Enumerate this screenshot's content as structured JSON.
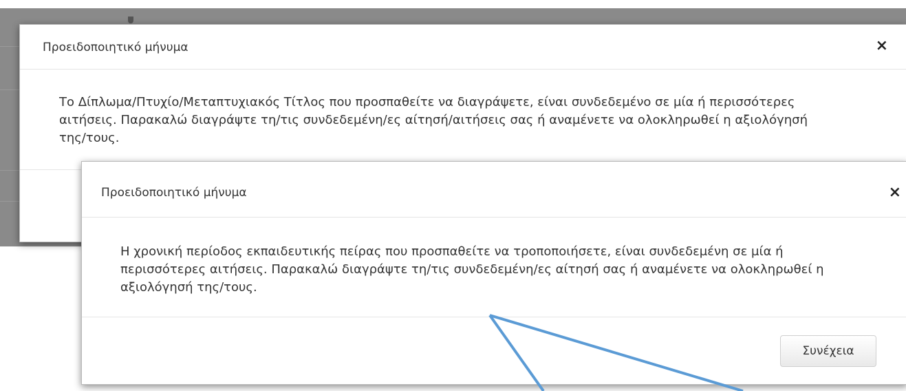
{
  "dialog_back": {
    "title": "Προειδοποιητικό μήνυμα",
    "close_symbol": "×",
    "message": "Το Δίπλωμα/Πτυχίο/Μεταπτυχιακός Τίτλος που προσπαθείτε να διαγράψετε, είναι συνδεδεμένο σε μία ή περισσότερες αιτήσεις. Παρακαλώ διαγράψτε τη/τις συνδεδεμένη/ες αίτησή/αιτήσεις σας ή αναμένετε να ολοκληρωθεί η αξιολόγησή της/τους."
  },
  "dialog_front": {
    "title": "Προειδοποιητικό μήνυμα",
    "close_symbol": "×",
    "message": "Η χρονική περίοδος εκπαιδευτικής πείρας που προσπαθείτε να τροποποιήσετε, είναι συνδεδεμένη σε μία ή περισσότερες αιτήσεις. Παρακαλώ διαγράψτε τη/τις συνδεδεμένη/ες αίτησή σας ή αναμένετε να ολοκληρωθεί η αξιολόγησή της/τους.",
    "continue_label": "Συνέχεια"
  },
  "colors": {
    "overlay": "#8a8a8a",
    "annotation_arrow": "#5b9bd5"
  },
  "icons": {
    "close": "close-icon",
    "annotation": "arrow-annotation"
  }
}
